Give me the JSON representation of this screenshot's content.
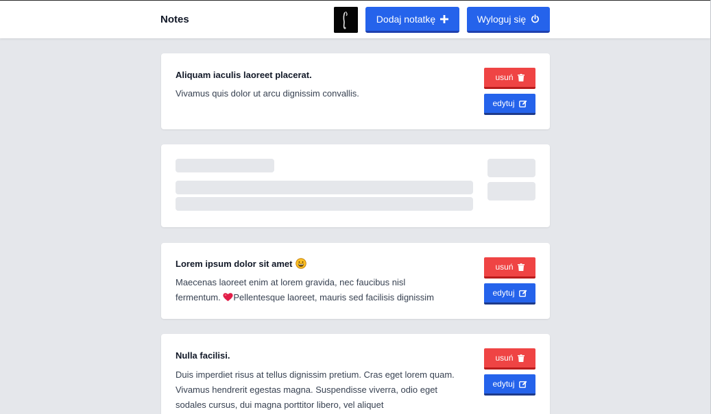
{
  "header": {
    "brand": "Notes",
    "add_note_label": "Dodaj notatkę",
    "logout_label": "Wyloguj się"
  },
  "notes": [
    {
      "title": "Aliquam iaculis laoreet placerat.",
      "body": "Vivamus quis dolor ut arcu dignissim convallis.",
      "delete_label": "usuń",
      "edit_label": "edytuj"
    },
    {
      "loading": true
    },
    {
      "title": "Lorem ipsum dolor sit amet",
      "body_line_1": "Maecenas laoreet enim at lorem gravida, nec faucibus nisl",
      "body_line_2_before": "fermentum.",
      "body_line_2_after": "Pellentesque laoreet, mauris sed facilisis dignissim",
      "delete_label": "usuń",
      "edit_label": "edytuj"
    },
    {
      "title": "Nulla facilisi.",
      "body": "Duis imperdiet risus at tellus dignissim pretium. Cras eget lorem quam. Vivamus hendrerit egestas magna. Suspendisse viverra, odio eget sodales cursus, dui magna porttitor libero, vel aliquet",
      "delete_label": "usuń",
      "edit_label": "edytuj"
    }
  ],
  "icons": {
    "add": "plus-icon",
    "logout": "power-icon",
    "delete": "trash-icon",
    "edit": "edit-icon",
    "title_emoji": "grinning-face-icon",
    "body_emoji": "heart-icon"
  },
  "colors": {
    "primary": "#2563eb",
    "danger": "#ef4444",
    "background": "#e5e7eb",
    "card": "#ffffff"
  }
}
